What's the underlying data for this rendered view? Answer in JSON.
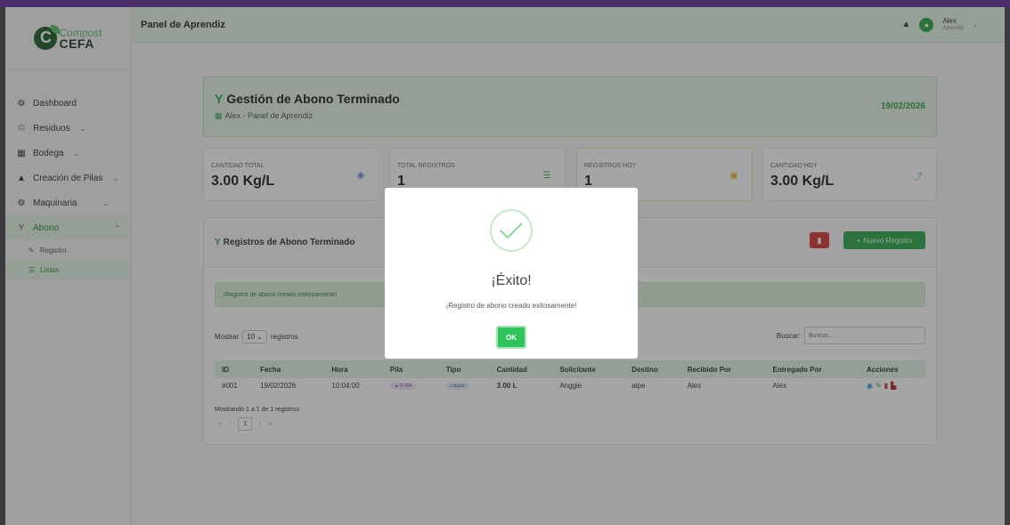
{
  "brand": {
    "line1": "Compost",
    "line2": "CEFA",
    "logo_letter": "C"
  },
  "sidebar": {
    "items": [
      {
        "label": "Dashboard",
        "icon": "⚙"
      },
      {
        "label": "Residuos",
        "icon": "♲",
        "chevron": "⌄"
      },
      {
        "label": "Bodega",
        "icon": "▦",
        "chevron": "⌄"
      },
      {
        "label": "Creación de Pilas",
        "icon": "▲",
        "chevron": "⌄"
      },
      {
        "label": "Maquinaria",
        "icon": "⚙",
        "chevron": "⌄"
      },
      {
        "label": "Abono",
        "icon": "Y",
        "chevron": "⌃"
      }
    ],
    "subitems": [
      {
        "label": "Registro",
        "icon": "✎"
      },
      {
        "label": "Listas",
        "icon": "☰"
      }
    ]
  },
  "topbar": {
    "title": "Panel de Aprendiz",
    "bell": "▲",
    "avatar_icon": "●",
    "user_name": "Alex",
    "user_role": "Aprendiz",
    "chevron": "⌄"
  },
  "header": {
    "title": "Gestión de Abono Terminado",
    "sprout": "Y",
    "subtitle": "Alex - Panel de Aprendiz",
    "sub_icon": "▦",
    "date": "19/02/2026"
  },
  "stats": [
    {
      "label": "CANTIDAD TOTAL",
      "value": "3.00 Kg/L",
      "icon": "◉",
      "color": "#5a8fd8"
    },
    {
      "label": "TOTAL REGISTROS",
      "value": "1",
      "icon": "☰",
      "color": "#2ea84a"
    },
    {
      "label": "REGISTROS HOY",
      "value": "1",
      "icon": "▣",
      "color": "#e0b83a"
    },
    {
      "label": "CANTIDAD HOY",
      "value": "3.00 Kg/L",
      "icon": "⤴",
      "color": "#5ab8d8"
    }
  ],
  "registros": {
    "title": "Registros de Abono Terminado",
    "pdf_icon": "▮",
    "new_label": "Nuevo Registro",
    "new_icon": "+",
    "alert": "¡Registro de abono creado exitosamente!",
    "show_label": "Mostrar",
    "show_value": "10",
    "show_suffix": "registros",
    "search_label": "Buscar:",
    "search_placeholder": "Buscar...",
    "columns": [
      "ID",
      "Fecha",
      "Hora",
      "Pila",
      "Tipo",
      "Cantidad",
      "Solicitante",
      "Destino",
      "Recibido Por",
      "Entregado Por",
      "Acciones"
    ],
    "rows": [
      {
        "id": "#001",
        "fecha": "19/02/2026",
        "hora": "10:04:00",
        "pila": "▲ P-304",
        "tipo": "Liquido",
        "cantidad": "3.00 L",
        "solicitante": "Anggie",
        "destino": "aipe",
        "recibido": "Alex",
        "entregado": "Alex"
      }
    ],
    "info": "Mostrando 1 a 1 de 1 registros",
    "pager": {
      "first": "«",
      "prev": "‹",
      "current": "1",
      "next": "›",
      "last": "»"
    }
  },
  "modal": {
    "title": "¡Éxito!",
    "text": "¡Registro de abono creado exitosamente!",
    "ok": "OK"
  }
}
